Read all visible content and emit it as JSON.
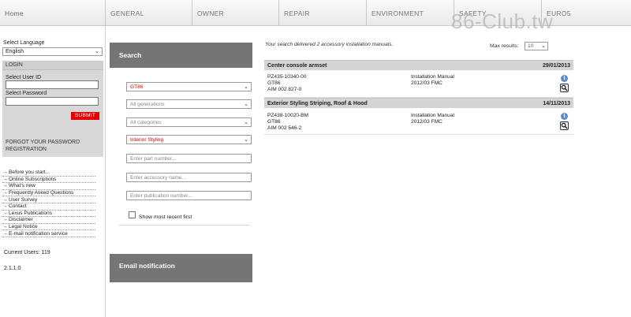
{
  "nav": {
    "tabs": [
      "Home",
      "GENERAL",
      "OWNER",
      "REPAIR",
      "ENVIRONMENT",
      "SAFETY",
      "EURO5"
    ]
  },
  "watermark": "86-Club.tw",
  "sidebar": {
    "language_label": "Select Language",
    "language_value": "English",
    "login": {
      "title": "LOGIN",
      "user_id_label": "Select User ID",
      "password_label": "Select Password",
      "submit_label": "SUBMIT",
      "forgot_link": "FORGOT YOUR PASSWORD",
      "registration_link": "REGISTRATION"
    },
    "links": [
      "Before you start...",
      "Online Subscriptions",
      "What's new",
      "Frequently Asked Questions",
      "User Survey",
      "Contact",
      "Lexus Publications",
      "Disclaimer",
      "Legal Notice",
      "E-mail notification service"
    ],
    "current_users": "Current Users: 119",
    "version": "2.1.1.0"
  },
  "search": {
    "title": "Search",
    "model": "GT86",
    "generations": "All generations",
    "categories": "All categories",
    "category_selected": "Interior Styling",
    "part_placeholder": "Enter part number...",
    "accessory_placeholder": "Enter accessory name...",
    "publication_placeholder": "Enter publication number...",
    "recent_label": "Show most recent first"
  },
  "email": {
    "title": "Email notification"
  },
  "results": {
    "summary": "Your search delivered 2 accessory installation manuals.",
    "max_label": "Max results:",
    "max_value": "10",
    "items": [
      {
        "title": "Center console armset",
        "date": "29/01/2013",
        "part": "PZ435-10340-00",
        "model": "GT86",
        "aim": "AIM 002 827-0",
        "type": "Installation Manual",
        "fmc": "2012/03 FMC"
      },
      {
        "title": "Exterior Styling Striping, Roof & Hood",
        "date": "14/11/2013",
        "part": "PZ438-10020-BM",
        "model": "GT86",
        "aim": "AIM 002 546-2",
        "type": "Installation Manual",
        "fmc": "2012/03 FMC"
      }
    ]
  },
  "icons": {
    "info": "info-icon",
    "magnifier": "magnifier-icon",
    "arrow": "arrow-right-icon",
    "chevron": "chevron-down-icon"
  }
}
